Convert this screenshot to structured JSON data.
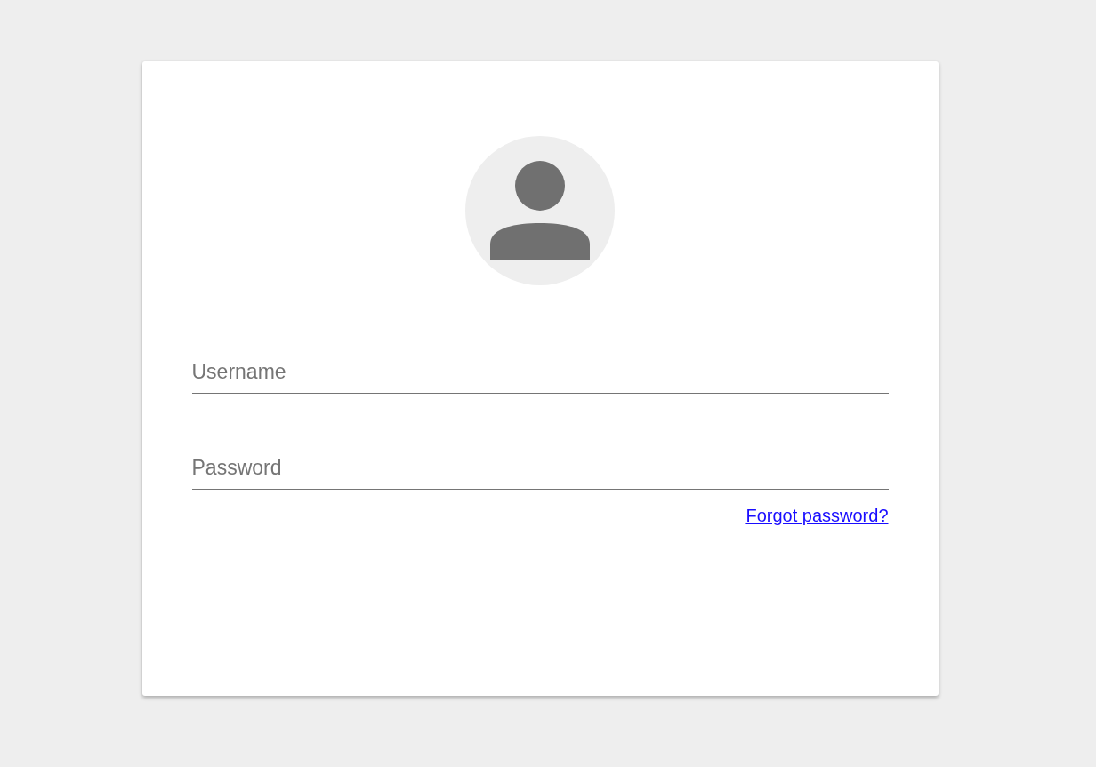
{
  "login_card": {
    "fields": [
      {
        "placeholder": "Username"
      },
      {
        "placeholder": "Password"
      }
    ],
    "forgot_link": "Forgot password?"
  }
}
